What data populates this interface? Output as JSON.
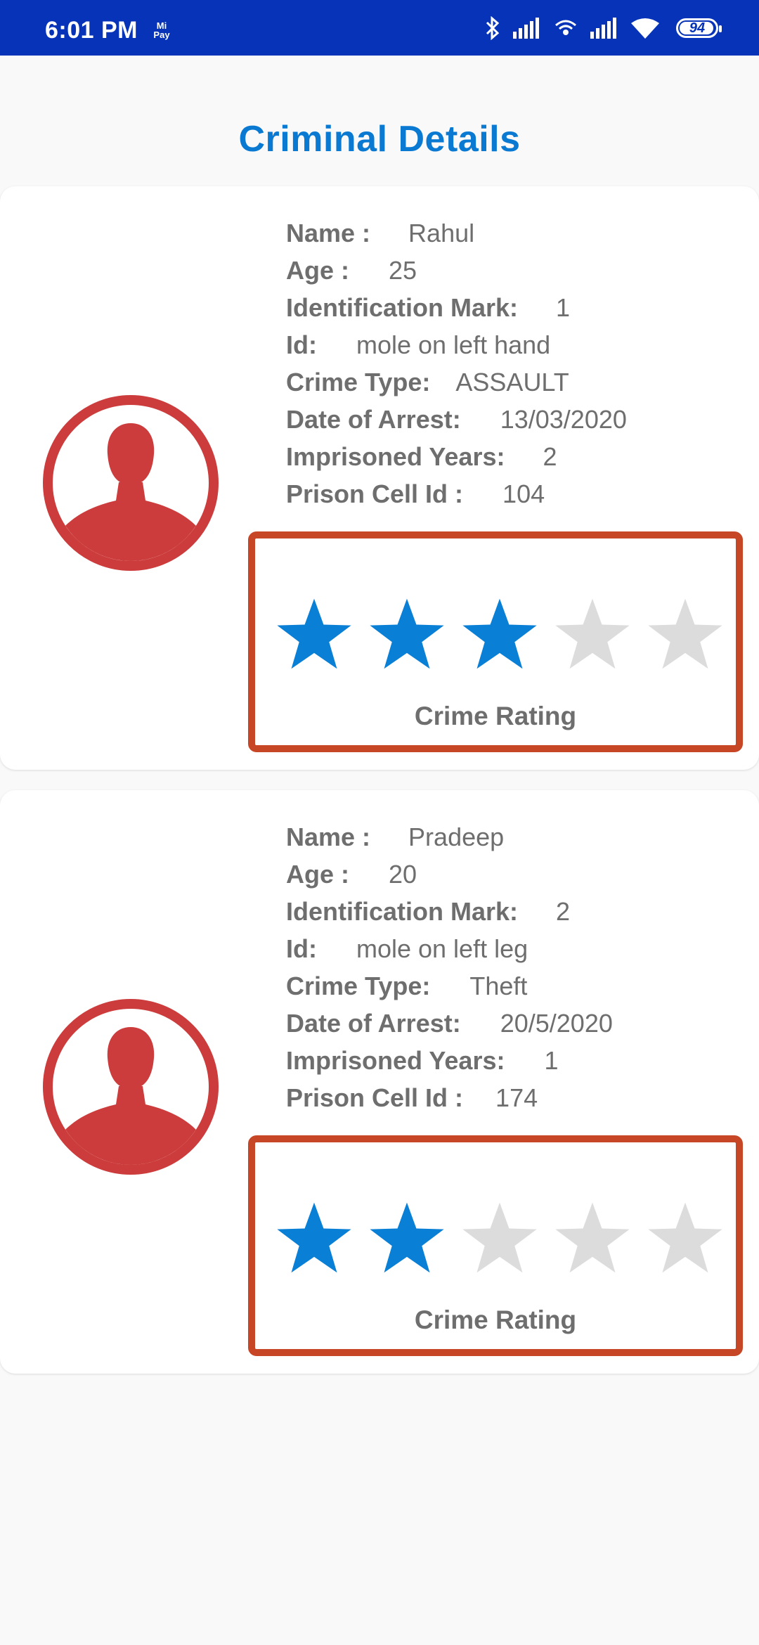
{
  "status": {
    "time": "6:01 PM",
    "mipay": "Mi Pay",
    "battery": "94"
  },
  "page": {
    "title": "Criminal Details"
  },
  "criminals": [
    {
      "name_label": "Name :",
      "name": "Rahul",
      "age_label": "Age :",
      "age": "25",
      "mark_label": "Identification Mark:",
      "mark": "1",
      "id_label": "Id:",
      "id": "mole on left hand",
      "crime_label": "Crime Type:",
      "crime": "ASSAULT",
      "arrest_label": "Date of Arrest:",
      "arrest": "13/03/2020",
      "years_label": "Imprisoned Years:",
      "years": "2",
      "cell_label": "Prison Cell Id :",
      "cell": "104",
      "rating": 3,
      "rating_max": 5,
      "rating_label": "Crime Rating"
    },
    {
      "name_label": "Name :",
      "name": "Pradeep",
      "age_label": "Age :",
      "age": "20",
      "mark_label": "Identification Mark:",
      "mark": "2",
      "id_label": "Id:",
      "id": "mole on left leg",
      "crime_label": "Crime Type:",
      "crime": "Theft",
      "arrest_label": "Date of Arrest:",
      "arrest": "20/5/2020",
      "years_label": "Imprisoned Years:",
      "years": "1",
      "cell_label": "Prison Cell Id :",
      "cell": "174",
      "rating": 2,
      "rating_max": 5,
      "rating_label": "Crime Rating"
    }
  ],
  "colors": {
    "status_bar": "#0633b7",
    "title": "#0a79d2",
    "star_filled": "#0a7fd6",
    "star_empty": "#dcdcdc",
    "rating_border": "#c64625",
    "avatar": "#cc3c3c"
  },
  "icons": {
    "avatar": "user-avatar-icon",
    "star": "star-icon"
  }
}
